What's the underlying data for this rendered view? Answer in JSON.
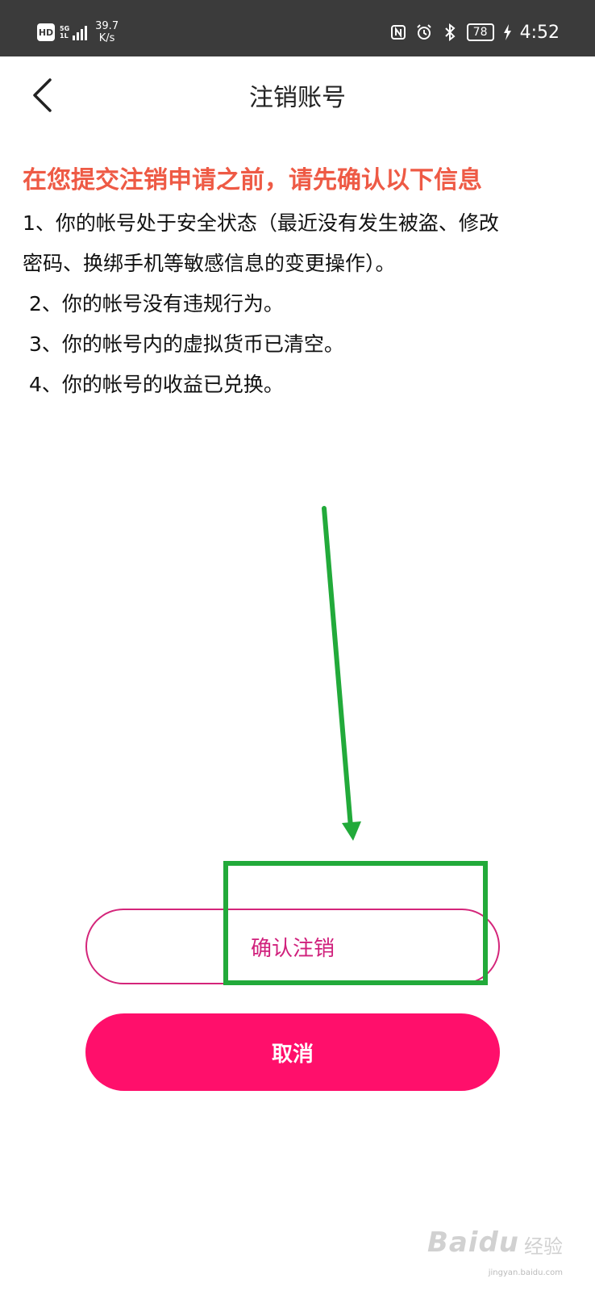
{
  "status_bar": {
    "hd": "HD",
    "network_5g": "5G",
    "network_sub": "1L",
    "speed_value": "39.7",
    "speed_unit": "K/s",
    "battery": "78",
    "time": "4:52",
    "icons": [
      "nfc-icon",
      "alarm-icon",
      "bluetooth-icon",
      "charging-icon"
    ]
  },
  "header": {
    "title": "注销账号",
    "back_icon": "chevron-left-icon"
  },
  "notice": {
    "warning": "在您提交注销申请之前，请先确认以下信息",
    "items": [
      "1、你的帐号处于安全状态（最近没有发生被盗、修改",
      "密码、换绑手机等敏感信息的变更操作）。",
      "2、你的帐号没有违规行为。",
      "3、你的帐号内的虚拟货币已清空。",
      "4、你的帐号的收益已兑换。"
    ]
  },
  "buttons": {
    "confirm_label": "确认注销",
    "cancel_label": "取消"
  },
  "colors": {
    "warning": "#ee5a45",
    "confirm_border": "#d4257a",
    "cancel_bg": "#ff0f6b",
    "annotation": "#22aa3a"
  },
  "watermark": {
    "brand": "Baidu",
    "brand_cn": "经验",
    "url": "jingyan.baidu.com"
  }
}
